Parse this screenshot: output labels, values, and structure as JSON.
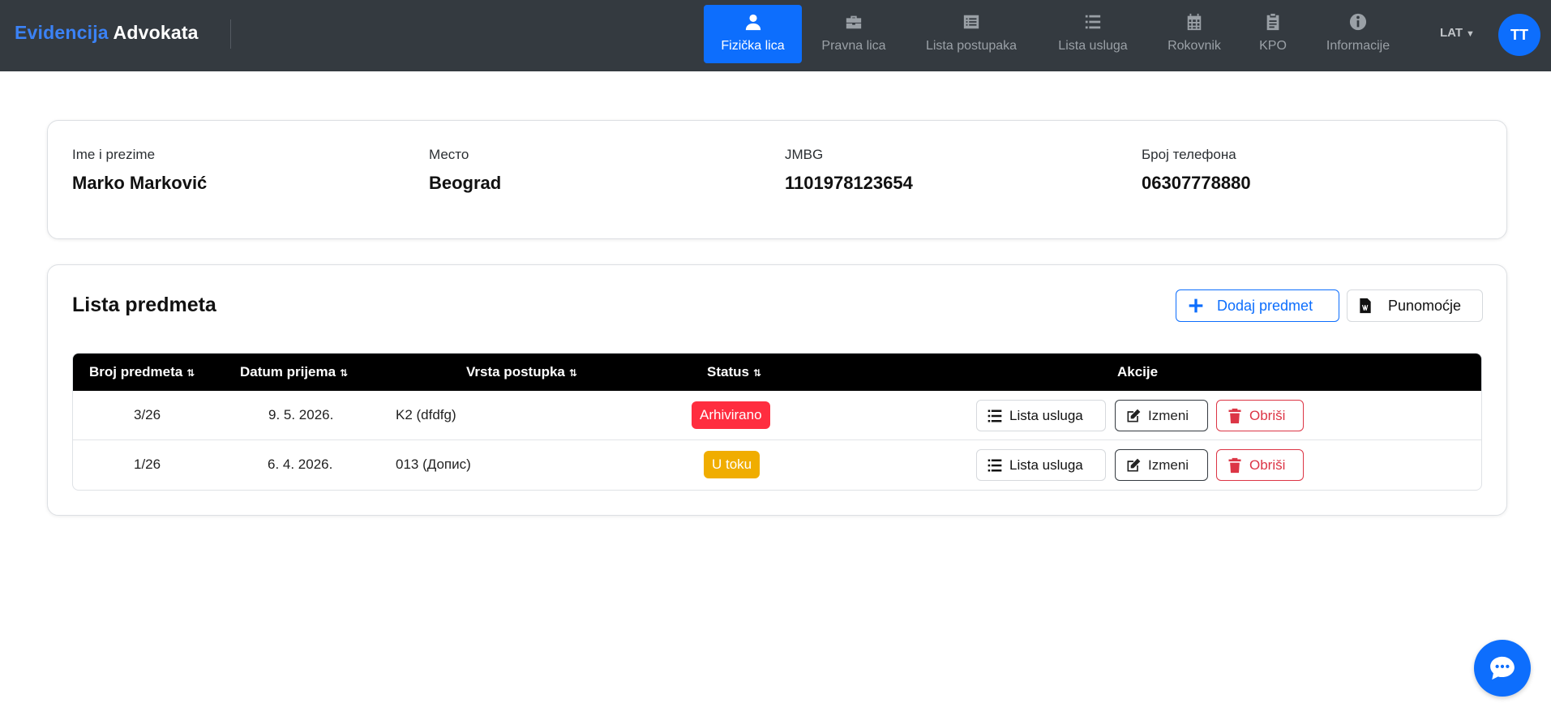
{
  "brand": {
    "part1": "Evidencija",
    "part2": "Advokata"
  },
  "nav": {
    "items": [
      {
        "label": "Fizička lica",
        "icon": "user-icon",
        "active": true
      },
      {
        "label": "Pravna lica",
        "icon": "briefcase-icon",
        "active": false
      },
      {
        "label": "Lista postupaka",
        "icon": "list-alt-icon",
        "active": false
      },
      {
        "label": "Lista usluga",
        "icon": "list-icon",
        "active": false
      },
      {
        "label": "Rokovnik",
        "icon": "calendar-icon",
        "active": false
      },
      {
        "label": "KPO",
        "icon": "clipboard-icon",
        "active": false
      },
      {
        "label": "Informacije",
        "icon": "info-icon",
        "active": false
      }
    ],
    "lang": "LAT",
    "avatar": "TT"
  },
  "client": {
    "name_label": "Ime i prezime",
    "name_value": "Marko Marković",
    "city_label": "Место",
    "city_value": "Beograd",
    "jmbg_label": "JMBG",
    "jmbg_value": "1101978123654",
    "phone_label": "Број телефона",
    "phone_value": "06307778880"
  },
  "cases": {
    "title": "Lista predmeta",
    "add_label": "Dodaj predmet",
    "power_label": "Punomoćje",
    "columns": {
      "number": "Broj predmeta",
      "date": "Datum prijema",
      "type": "Vrsta postupka",
      "status": "Status",
      "actions": "Akcije"
    },
    "rows": [
      {
        "number": "3/26",
        "date": "9. 5. 2026.",
        "type": "K2 (dfdfg)",
        "status": "Arhivirano",
        "status_color": "#ff2d3f"
      },
      {
        "number": "1/26",
        "date": "6. 4. 2026.",
        "type": "013 (Допис)",
        "status": "U toku",
        "status_color": "#f0ad00"
      }
    ],
    "row_actions": {
      "list": "Lista usluga",
      "edit": "Izmeni",
      "delete": "Obriši"
    }
  },
  "colors": {
    "primary": "#0d6efd",
    "danger": "#dc3545",
    "nav_bg": "#343a40"
  }
}
